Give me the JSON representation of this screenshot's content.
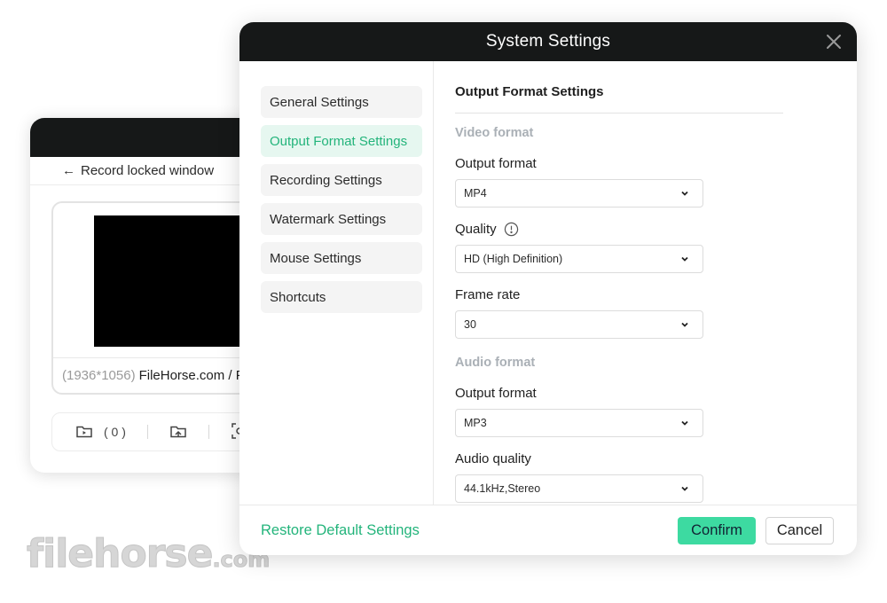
{
  "background_window": {
    "back_label": "Record locked window",
    "preview_resolution": "(1936*1056)",
    "preview_title": "FileHorse.com / F",
    "toolbar": {
      "folder_count": "( 0 )"
    }
  },
  "watermark": {
    "name": "filehorse",
    "suffix": ".com"
  },
  "dialog": {
    "title": "System Settings",
    "nav": [
      {
        "label": "General Settings"
      },
      {
        "label": "Output Format Settings",
        "active": true
      },
      {
        "label": "Recording Settings"
      },
      {
        "label": "Watermark Settings"
      },
      {
        "label": "Mouse Settings"
      },
      {
        "label": "Shortcuts"
      }
    ],
    "section_title": "Output Format Settings",
    "video": {
      "heading": "Video format",
      "output_format": {
        "label": "Output format",
        "value": "MP4"
      },
      "quality": {
        "label": "Quality",
        "value": "HD (High Definition)"
      },
      "frame_rate": {
        "label": "Frame rate",
        "value": "30"
      }
    },
    "audio": {
      "heading": "Audio format",
      "output_format": {
        "label": "Output format",
        "value": "MP3"
      },
      "audio_quality": {
        "label": "Audio quality",
        "value": "44.1kHz,Stereo"
      }
    },
    "footer": {
      "restore_label": "Restore Default Settings",
      "confirm_label": "Confirm",
      "cancel_label": "Cancel"
    }
  },
  "colors": {
    "accent": "#23b47b",
    "confirm_bg": "#3ddaa1",
    "titlebar": "#161818",
    "active_nav_bg": "#e6f7f0"
  },
  "icons": [
    "close-icon",
    "chevron-down-icon",
    "info-icon",
    "back-arrow-icon",
    "folder-play-icon",
    "export-icon",
    "screenshot-icon"
  ]
}
